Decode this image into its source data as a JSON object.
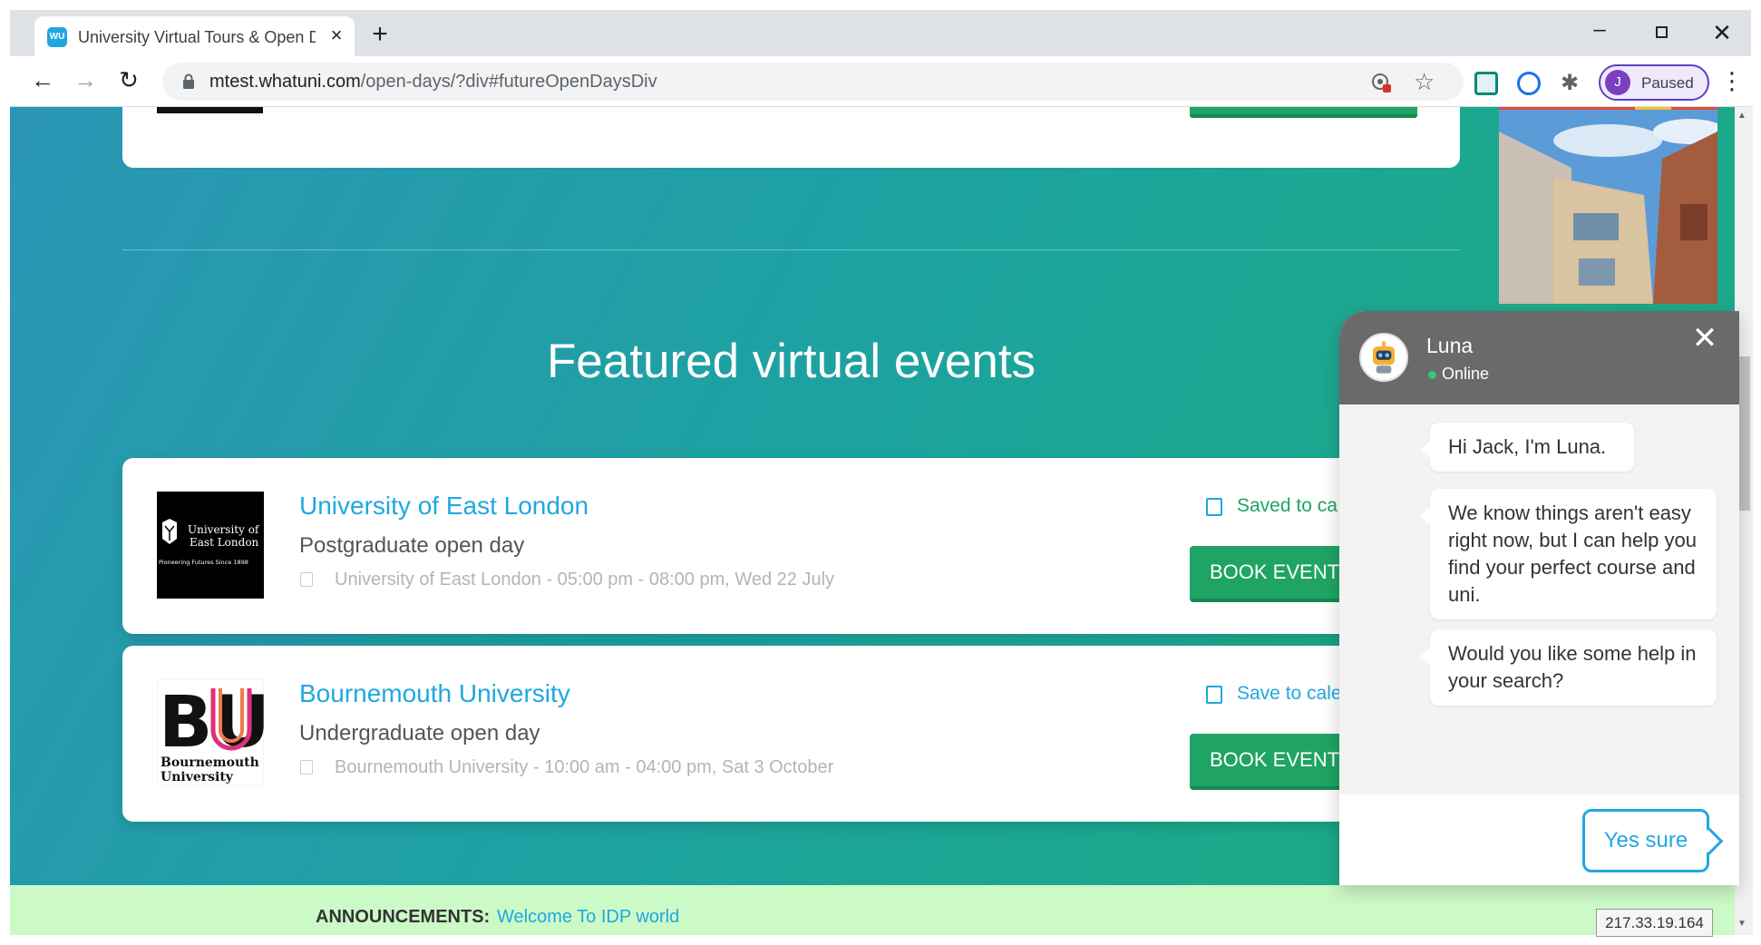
{
  "browser": {
    "tab_title": "University Virtual Tours & Open D",
    "favicon_text": "WU",
    "url_host": "mtest.whatuni.com",
    "url_path": "/open-days/?div#futureOpenDaysDiv",
    "profile_initial": "J",
    "profile_label": "Paused"
  },
  "page": {
    "section_title": "Featured virtual events",
    "events": [
      {
        "university": "University of East London",
        "event_type": "Postgraduate open day",
        "when": "University of East London - 05:00 pm - 08:00 pm, Wed 22 July",
        "save_label": "Saved to ca",
        "book_label": "BOOK EVENT"
      },
      {
        "university": "Bournemouth University",
        "event_type": "Undergraduate open day",
        "when": "Bournemouth University - 10:00 am - 04:00 pm, Sat 3 October",
        "save_label": "Save to cale",
        "book_label": "BOOK EVENT"
      }
    ],
    "logos": {
      "uel_line1": "University of",
      "uel_line2": "East London",
      "uel_tagline": "Pioneering Futures Since 1898",
      "bu_mark": "BU",
      "bu_line1": "Bournemouth",
      "bu_line2": "University"
    },
    "announcement_label": "ANNOUNCEMENTS:",
    "announcement_link": "Welcome To IDP world",
    "ip_badge": "217.33.19.164"
  },
  "chat": {
    "bot_name": "Luna",
    "status": "Online",
    "messages": [
      "Hi Jack, I'm Luna.",
      "We know things aren't easy right now, but I can help you find your perfect course and uni.",
      "Would you like some help in your search?"
    ],
    "reply_option": "Yes sure"
  },
  "colors": {
    "brand_blue": "#21a7e0",
    "book_green": "#1fa463",
    "teal_start": "#2a96b5",
    "teal_end": "#1ba68a",
    "announce_bg": "#ccfac7",
    "chat_header": "#6a6a6a"
  },
  "icons": {
    "back": "arrow-left",
    "forward": "arrow-right",
    "reload": "reload",
    "lock": "lock",
    "star": "star",
    "extensions": "puzzle",
    "menu": "vertical-dots",
    "calendar": "calendar",
    "close": "close"
  }
}
